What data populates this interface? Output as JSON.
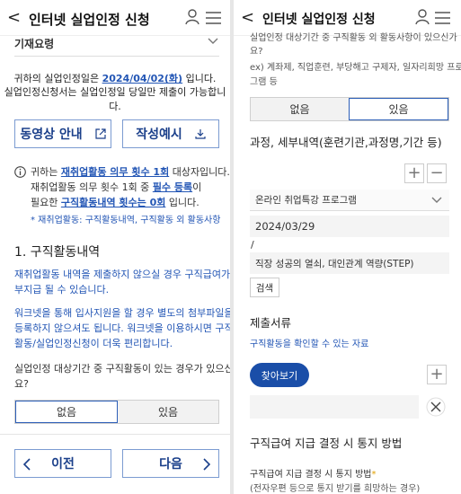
{
  "left": {
    "header": {
      "back": "<",
      "title": "인터넷 실업인정 신청"
    },
    "collapsed_section": "기재요령",
    "notice": {
      "line1_pre": "귀하의 실업인정일은 ",
      "line1_date": "2024/04/02(화)",
      "line1_post": " 입니다.",
      "line2": "실업인정신청서는 실업인정일 당일만 제출이 가능합니다."
    },
    "video_button": "동영상 안내",
    "example_button": "작성예시",
    "info": {
      "l1_pre": "귀하는 ",
      "l1_link": "재취업활동 의무 횟수 1회",
      "l1_post": " 대상자입니다.",
      "l2_pre": "재취업활동 의무 횟수 1회 중 ",
      "l2_link": "필수 등록",
      "l2_post": "이",
      "l3_pre": "필요한 ",
      "l3_link": "구직활동내역 횟수는 0회",
      "l3_post": " 입니다.",
      "l4": "* 재취업활동: 구직활동내역, 구직활동 외 활동사항"
    },
    "section_title": "1. 구직활동내역",
    "para1_l1": "재취업활동 내역을 제출하지 않으실 경우 구직급여가",
    "para1_l2": "부지급 될 수 있습니다.",
    "para2_l1": "워크넷을 통해 입사지원을 할 경우 별도의 첨부파일을",
    "para2_l2": "등록하지 않으셔도 됩니다. 워크넷을 이용하시면 구직",
    "para2_l3": "활동/실업인정신청이 더욱 편리합니다.",
    "question_l1": "실업인정 대상기간 중 구직활동이 있는 경우가 있으신가",
    "question_l2": "요?",
    "option_no": "없음",
    "option_yes": "있음",
    "prev_button": "이전",
    "next_button": "다음"
  },
  "right": {
    "header": {
      "back": "<",
      "title": "인터넷 실업인정 신청"
    },
    "question_l1": "실업인정 대상기간 중 구직활동 외 활동사항이 있으신가",
    "question_l2": "요?",
    "example_l1": "ex) 계좌제, 직업훈련, 부당해고 구제자, 일자리희망 프로",
    "example_l2": "그램 등",
    "option_no": "없음",
    "option_yes": "있음",
    "course_title": "과정, 세부내역(훈련기관,과정명,기간 등)",
    "plus": "+",
    "minus": "−",
    "select_value": "온라인 취업특강 프로그램",
    "date_value": "2024/03/29",
    "slash": "/",
    "detail_value": "직장 성공의 열쇠, 대인관계 역량(STEP)",
    "search_button": "검색",
    "docs_title": "제출서류",
    "docs_sub": "구직활동을 확인할 수 있는 자료",
    "browse_button": "찾아보기",
    "decision_title": "구직급여 지급 결정 시 통지 방법",
    "notify_label": "구직급여 지급 결정 시 통지 방법",
    "required_mark": "*",
    "notify_sub": "(전자우편 등으로 통지 받기를 희망하는 경우)"
  }
}
